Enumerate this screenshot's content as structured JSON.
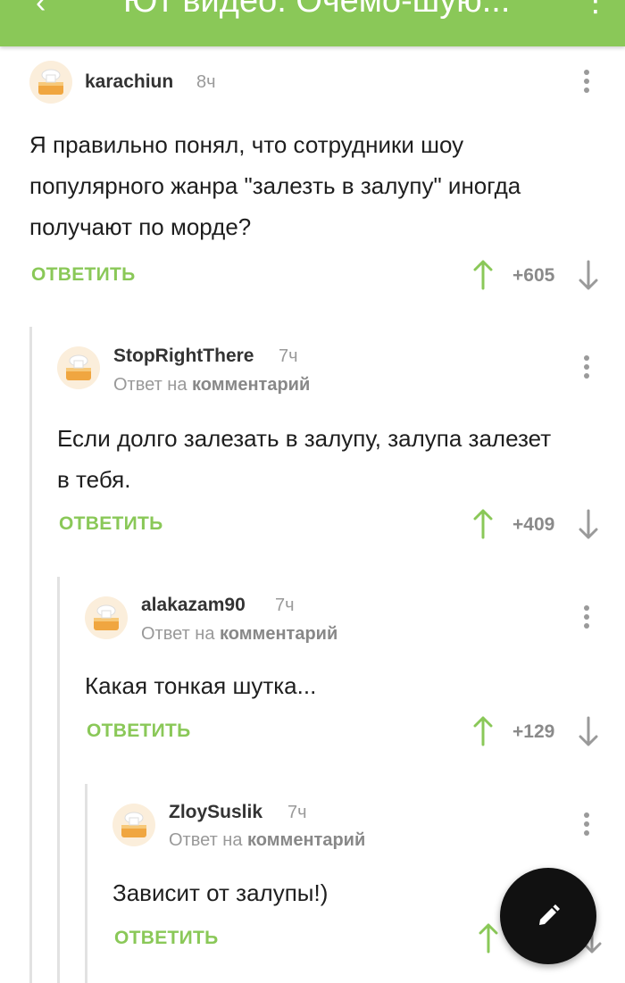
{
  "topbar": {
    "title": "Ют видео. Очемо-шую...",
    "back_icon": "arrow-back-icon",
    "more_icon": "more-vertical-icon"
  },
  "colors": {
    "accent": "#8ac858",
    "fab": "#111111"
  },
  "reply_label": "ОТВЕТИТЬ",
  "reply_to_prefix": "Ответ на",
  "reply_to_target": "комментарий",
  "comments": [
    {
      "username": "karachiun",
      "time": "8ч",
      "text": "Я правильно понял, что сотрудники шоу популярного жанра \"залезть в залупу\" иногда получают по морде?",
      "score": "+605"
    },
    {
      "username": "StopRightThere",
      "time": "7ч",
      "text": "Если долго залезать в залупу, залупа залезет в тебя.",
      "score": "+409"
    },
    {
      "username": "alakazam90",
      "time": "7ч",
      "text": "Какая тонкая шутка...",
      "score": "+129"
    },
    {
      "username": "ZloySuslik",
      "time": "7ч",
      "text": "Зависит от залупы!)",
      "score": ""
    }
  ],
  "fab": {
    "icon": "pencil-icon"
  }
}
